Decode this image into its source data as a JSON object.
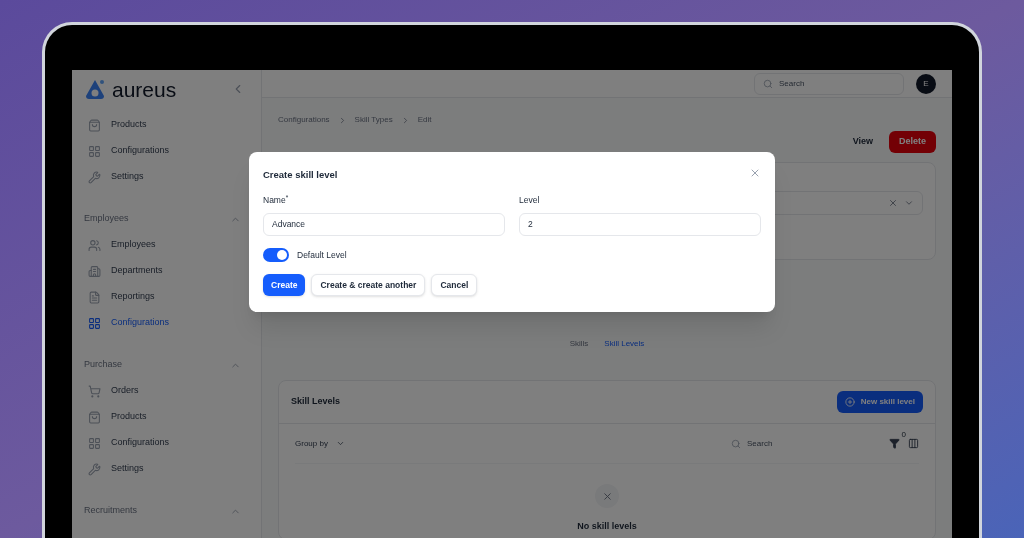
{
  "logo": {
    "text": "aureus"
  },
  "sidebar": {
    "groups": [
      {
        "items": [
          {
            "label": "Products",
            "selected": false
          },
          {
            "label": "Configurations",
            "selected": false
          },
          {
            "label": "Settings",
            "selected": false
          }
        ]
      },
      {
        "label": "Employees",
        "expanded": true,
        "items": [
          {
            "label": "Employees",
            "selected": false
          },
          {
            "label": "Departments",
            "selected": false
          },
          {
            "label": "Reportings",
            "selected": false
          },
          {
            "label": "Configurations",
            "selected": true
          }
        ]
      },
      {
        "label": "Purchase",
        "expanded": true,
        "items": [
          {
            "label": "Orders",
            "selected": false
          },
          {
            "label": "Products",
            "selected": false
          },
          {
            "label": "Configurations",
            "selected": false
          },
          {
            "label": "Settings",
            "selected": false
          }
        ]
      },
      {
        "label": "Recruitments",
        "expanded": true
      }
    ]
  },
  "topbar": {
    "search": {
      "placeholder": "Search"
    },
    "avatar": "E"
  },
  "breadcrumbs": [
    "Configurations",
    "Skill Types",
    "Edit"
  ],
  "header_actions": {
    "view": "View",
    "delete": "Delete"
  },
  "tabs": [
    {
      "label": "Skills",
      "selected": false
    },
    {
      "label": "Skill Levels",
      "selected": true
    }
  ],
  "skill_levels": {
    "title": "Skill Levels",
    "new_button": "New skill level",
    "group_by": "Group by",
    "search": {
      "placeholder": "Search"
    },
    "filter_count": "0",
    "empty": "No skill levels"
  },
  "modal": {
    "title": "Create skill level",
    "name": {
      "label": "Name$^{*}$",
      "value": "Advance"
    },
    "level": {
      "label": "Level",
      "value": "2"
    },
    "default_level": {
      "label": "Default Level",
      "on": true
    },
    "buttons": [
      "Create",
      "Create & create another",
      "Cancel"
    ]
  }
}
